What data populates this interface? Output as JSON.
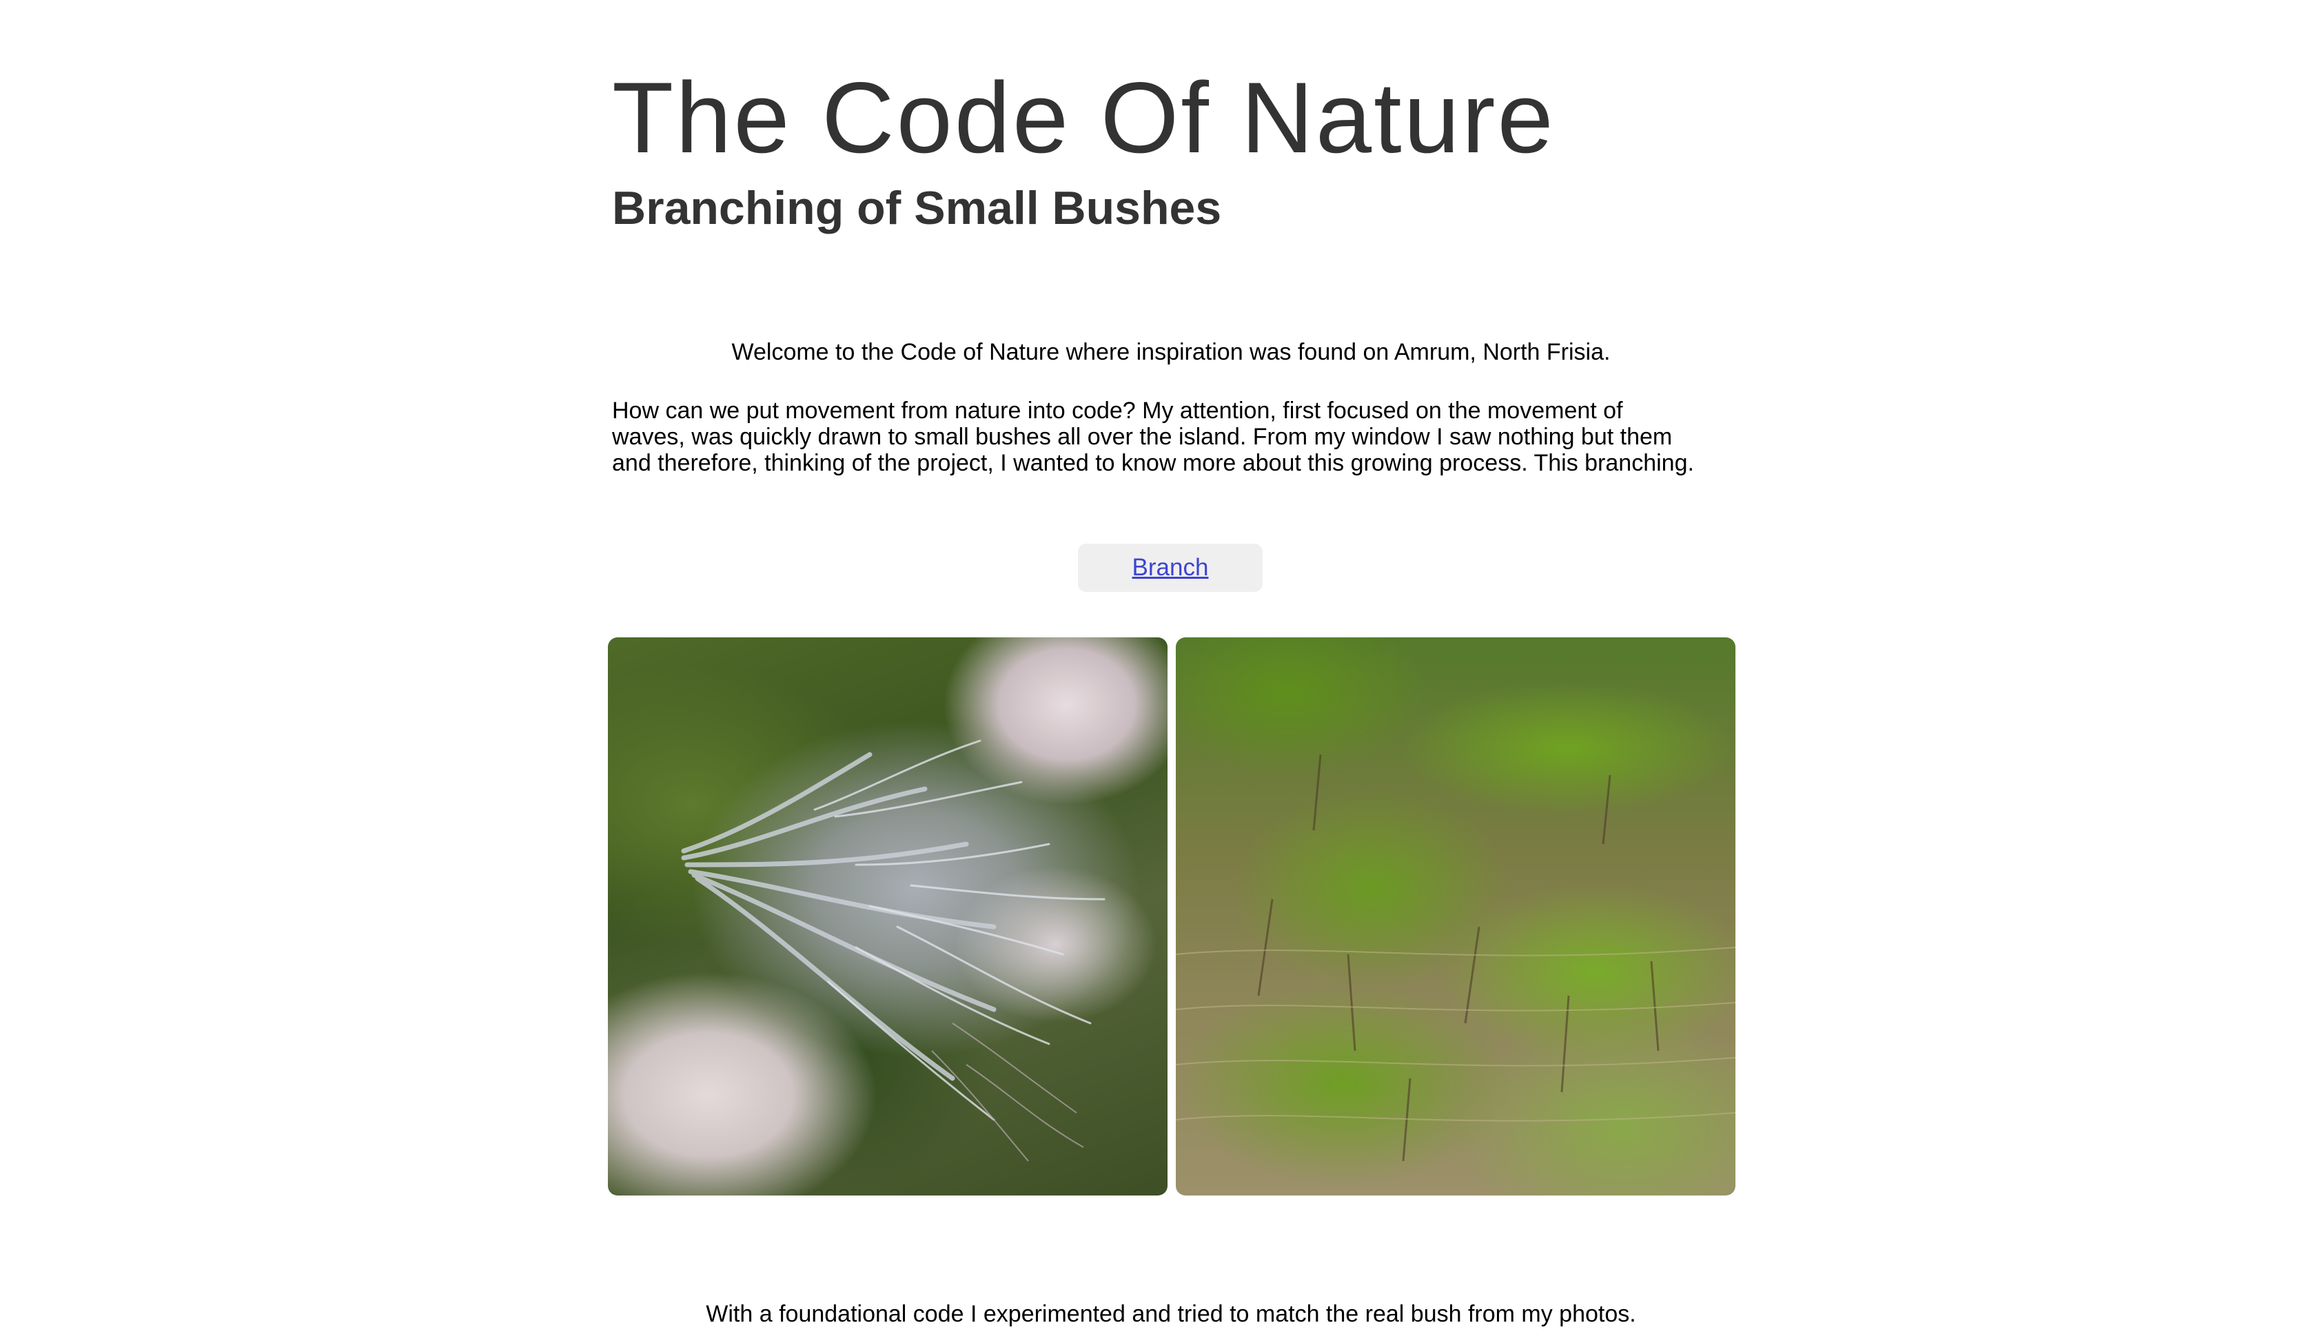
{
  "header": {
    "title": "The Code Of Nature",
    "subtitle": "Branching of Small Bushes"
  },
  "content": {
    "welcome": "Welcome to the Code of Nature where inspiration was found on Amrum, North Frisia.",
    "intro": "How can we put movement from nature into code? My attention, first focused on the movement of waves, was quickly drawn to small bushes all over the island. From my window I saw nothing but them and therefore, thinking of the project, I wanted to know more about this growing process. This branching.",
    "branch_link": "Branch",
    "closing": "With a foundational code I experimented and tried to match the real bush from my photos."
  },
  "colors": {
    "heading": "#333333",
    "link": "#3d44d1",
    "button_bg": "#efefef"
  },
  "images": [
    {
      "name": "heather-bush-photo",
      "subject": "silver-grey branching heather bush"
    },
    {
      "name": "green-shrubs-photo",
      "subject": "field of small green bushes in dry grass"
    }
  ]
}
